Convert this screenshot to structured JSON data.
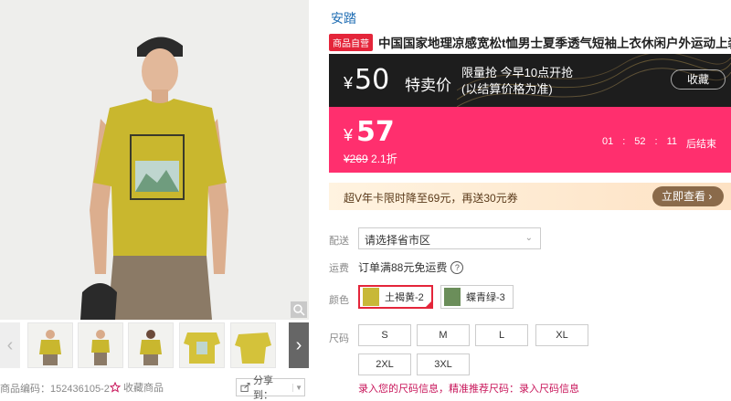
{
  "gallery": {
    "sku_label": "商品编码：152436105-2",
    "favorite_label": "收藏商品",
    "share_label": "分享到："
  },
  "product": {
    "brand": "安踏",
    "self_operated_badge": "商品自营",
    "title": "中国国家地理凉感宽松t恤男士夏季透气短袖上衣休闲户外运动上装"
  },
  "flash_sale": {
    "currency": "¥",
    "price": "50",
    "label": "特卖价",
    "line1": "限量抢  今早10点开抢",
    "line2": "(以结算价格为准)",
    "collect_label": "收藏"
  },
  "current_price": {
    "currency": "¥",
    "price": "57",
    "original": "¥269",
    "discount": "2.1折",
    "countdown": [
      "01",
      ":",
      "52",
      ":",
      "11",
      "后结束"
    ]
  },
  "vip": {
    "text": "超V年卡限时降至69元，再送30元券",
    "button_label": "立即查看 ›"
  },
  "options": {
    "delivery_label": "配送",
    "region_placeholder": "请选择省市区",
    "shipping_label": "运费",
    "shipping_value": "订单满88元免运费",
    "color_label": "颜色",
    "colors": [
      "土褐黄-2",
      "蝶青绿-3"
    ],
    "size_label": "尺码",
    "sizes": [
      "S",
      "M",
      "L",
      "XL",
      "2XL",
      "3XL"
    ],
    "size_link1": "录入您的尺码信息，精准推荐尺码：",
    "size_link2": "录入尺码信息"
  },
  "colors": {
    "accent": "#e4253a",
    "pink": "#ff2f6e",
    "link": "#1f6db3"
  }
}
